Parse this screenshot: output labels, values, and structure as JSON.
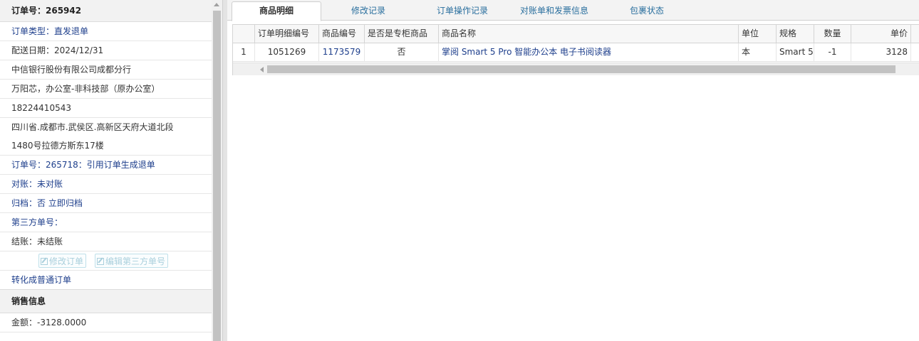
{
  "left": {
    "order_header": "订单号：265942",
    "rows": [
      "订单类型：直发退单",
      "配送日期：2024/12/31",
      "中信银行股份有限公司成都分行",
      "万阳芯，办公室-非科技部（原办公室）",
      "18224410543",
      "四川省.成都市.武侯区.高新区天府大道北段",
      "1480号拉德方斯东17楼",
      "订单号：265718：引用订单生成退单",
      "对账：未对账",
      "归档：否 立即归档",
      "第三方单号：",
      "结账：未结账"
    ],
    "buttons": {
      "edit_order": "修改订单",
      "edit_third_party": "编辑第三方单号"
    },
    "convert_link": "转化成普通订单",
    "sales_section": "销售信息",
    "amount": "金额：-3128.0000"
  },
  "tabs": [
    "商品明细",
    "修改记录",
    "订单操作记录",
    "对账单和发票信息",
    "包裹状态"
  ],
  "grid": {
    "headers": [
      "",
      "订单明细编号",
      "商品编号",
      "是否是专柜商品",
      "商品名称",
      "单位",
      "规格",
      "数量",
      "单价"
    ],
    "rows": [
      [
        "1",
        "1051269",
        "1173579",
        "否",
        "掌阅 Smart 5 Pro 智能办公本 电子书阅读器",
        "本",
        "Smart 5",
        "-1",
        "3128"
      ]
    ]
  },
  "colors": {
    "link_blue": "#1e3f8c",
    "tab_blue": "#2a6f9e",
    "disabled_button": "#a9cfdc"
  },
  "icons": {
    "button_icon": "edit-icon"
  }
}
